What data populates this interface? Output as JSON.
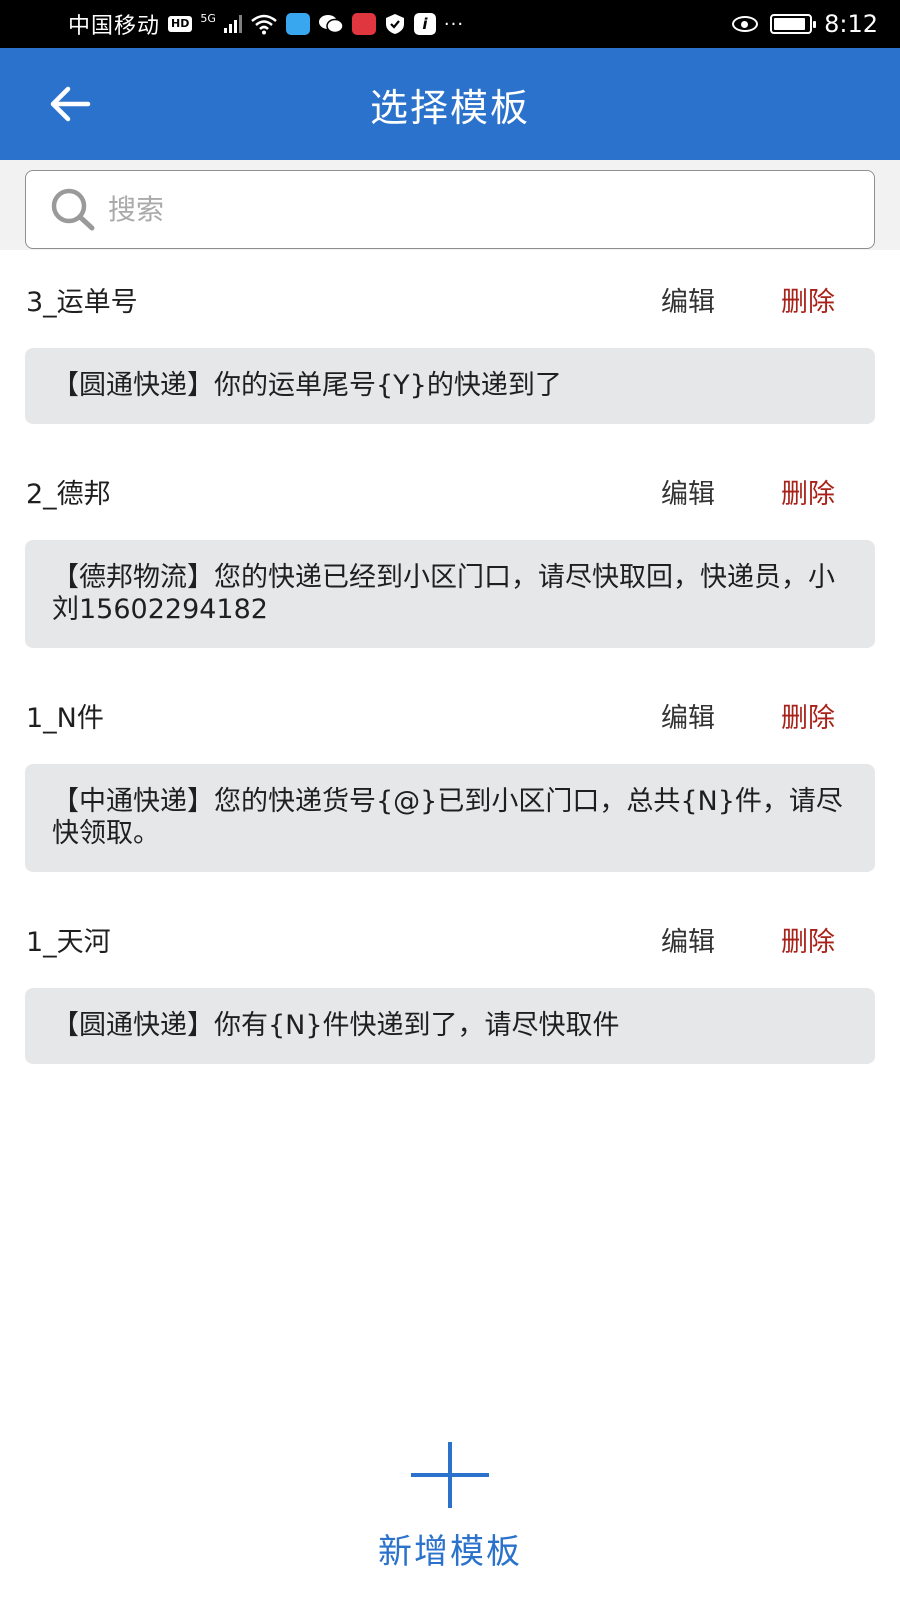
{
  "status_bar": {
    "carrier": "中国移动",
    "hd_badge": "HD",
    "network": "5G",
    "info_badge": "i",
    "more": "···",
    "time": "8:12",
    "battery_level": 0.9
  },
  "header": {
    "title": "选择模板",
    "back_icon": "arrow-left-icon",
    "color": "#2a72cb"
  },
  "search": {
    "placeholder": "搜索",
    "value": ""
  },
  "templates": [
    {
      "name": "3_运单号",
      "edit_label": "编辑",
      "delete_label": "删除",
      "content": "【圆通快递】你的运单尾号{Y}的快递到了"
    },
    {
      "name": "2_德邦",
      "edit_label": "编辑",
      "delete_label": "删除",
      "content": "【德邦物流】您的快递已经到小区门口，请尽快取回，快递员，小刘15602294182"
    },
    {
      "name": "1_N件",
      "edit_label": "编辑",
      "delete_label": "删除",
      "content": "【中通快递】您的快递货号{@}已到小区门口，总共{N}件，请尽快领取。"
    },
    {
      "name": "1_天河",
      "edit_label": "编辑",
      "delete_label": "删除",
      "content": "【圆通快递】你有{N}件快递到了，请尽快取件"
    }
  ],
  "add_button": {
    "label": "新增模板",
    "icon": "plus-icon"
  },
  "colors": {
    "accent": "#2a72cb",
    "delete": "#a8221a",
    "card_bg": "#e6e7e9"
  }
}
